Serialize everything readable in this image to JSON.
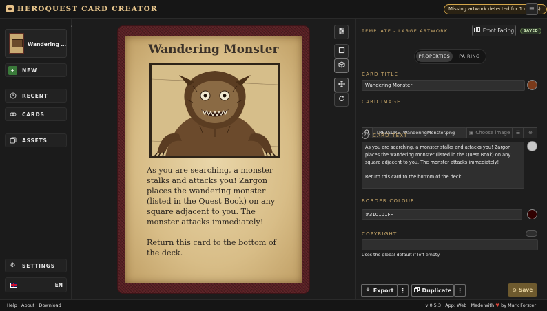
{
  "app": {
    "title": "HEROQUEST CARD CREATOR",
    "warning": "Missing artwork detected for 1 card(s).",
    "menu_icon": "hamburger-icon"
  },
  "sidebar": {
    "current_card_title": "Wandering ...",
    "new_label": "NEW",
    "recent_label": "RECENT",
    "cards_label": "CARDS",
    "assets_label": "ASSETS",
    "settings_label": "SETTINGS",
    "language_label": "EN"
  },
  "card": {
    "title": "Wandering Monster",
    "body_paragraphs": [
      "As you are searching, a monster stalks and attacks you! Zargon places the wandering monster (listed in the Quest Book) on any square adjacent to you. The monster attacks immediately!",
      "Return this card to the bottom of the deck."
    ],
    "border_color": "#310101",
    "parchment_color": "#d8bd87"
  },
  "panel": {
    "template_label": "TEMPLATE - LARGE ARTWORK",
    "face_button_label": "Front Facing",
    "saved_badge": "SAVED",
    "tabs": [
      {
        "label": "PROPERTIES",
        "active": true
      },
      {
        "label": "PAIRING",
        "active": false
      }
    ],
    "card_title_label": "CARD TITLE",
    "card_title_value": "Wandering Monster",
    "title_swatch_color": "#7a3a1a",
    "card_image_label": "CARD IMAGE",
    "card_image_value": "TREASURE- WanderingMonster.png",
    "choose_image_label": "Choose image",
    "card_text_label": "CARD TEXT",
    "card_text_paragraphs": [
      "As you are searching, a monster stalks and attacks you! Zargon places the wandering monster (listed in the Quest Book) on any square adjacent to you. The monster attacks immediately!",
      "Return this card to the bottom of the deck."
    ],
    "text_swatch_color": "#c8c8c8",
    "border_colour_label": "BORDER COLOUR",
    "border_colour_value": "#310101FF",
    "copyright_label": "COPYRIGHT",
    "copyright_value": "",
    "copyright_helper": "Uses the global default if left empty.",
    "export_label": "Export",
    "duplicate_label": "Duplicate",
    "save_label": "Save"
  },
  "footer": {
    "links": "Help · About · Download",
    "version_text": "v 0.5.3 · App: Web · Made with",
    "author_text": "by Mark Forster"
  }
}
